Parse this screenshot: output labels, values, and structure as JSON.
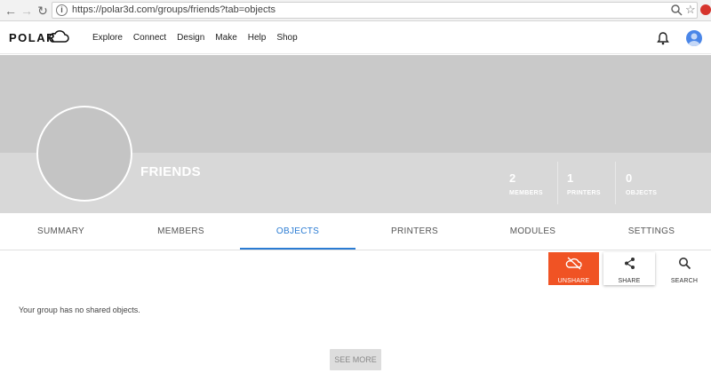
{
  "browser": {
    "url": "https://polar3d.com/groups/friends?tab=objects",
    "back_icon": "back-arrow-icon",
    "forward_icon": "forward-arrow-icon"
  },
  "header": {
    "logo_text": "POLAR",
    "nav": [
      "Explore",
      "Connect",
      "Design",
      "Make",
      "Help",
      "Shop"
    ]
  },
  "group": {
    "name": "FRIENDS",
    "stats": [
      {
        "value": "2",
        "label": "MEMBERS"
      },
      {
        "value": "1",
        "label": "PRINTERS"
      },
      {
        "value": "0",
        "label": "OBJECTS"
      }
    ]
  },
  "tabs": [
    "SUMMARY",
    "MEMBERS",
    "OBJECTS",
    "PRINTERS",
    "MODULES",
    "SETTINGS"
  ],
  "active_tab": "OBJECTS",
  "actions": {
    "unshare": "UNSHARE",
    "share": "SHARE",
    "search": "SEARCH"
  },
  "content": {
    "empty_message": "Your group has no shared objects.",
    "see_more": "SEE MORE"
  },
  "colors": {
    "accent": "#2b7cd3",
    "unshare": "#f05324",
    "banner": "#c9c9c9"
  }
}
